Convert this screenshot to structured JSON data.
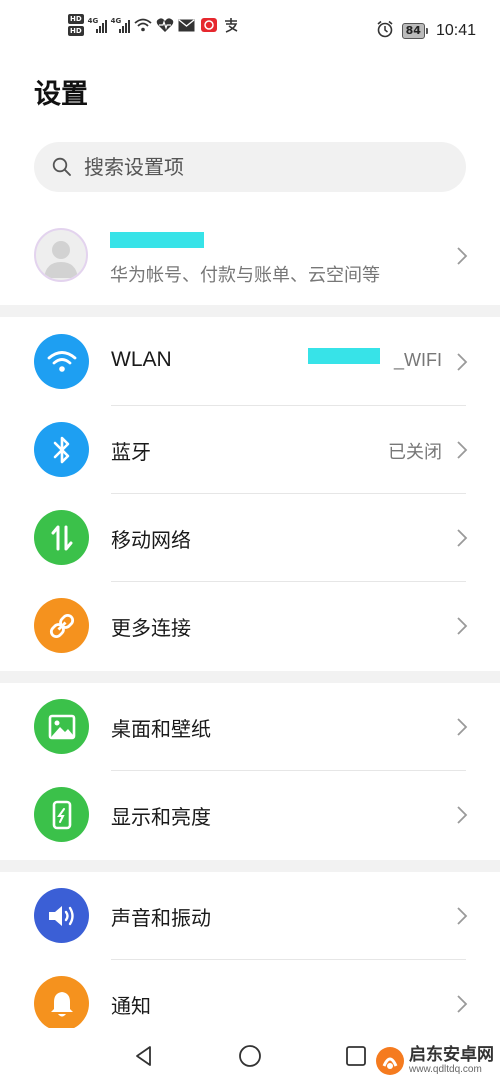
{
  "status_bar": {
    "hd_badge_1": "HD",
    "hd_badge_2": "HD",
    "network_1": "4G",
    "network_2": "4G",
    "battery": "84",
    "time": "10:41"
  },
  "page": {
    "title": "设置"
  },
  "search": {
    "placeholder": "搜索设置项"
  },
  "account": {
    "subtitle": "华为帐号、付款与账单、云空间等"
  },
  "items": [
    {
      "label": "WLAN",
      "value": "_WIFI",
      "icon": "wifi-icon",
      "color": "#1e9ff2"
    },
    {
      "label": "蓝牙",
      "value": "已关闭",
      "icon": "bluetooth-icon",
      "color": "#1e9ff2"
    },
    {
      "label": "移动网络",
      "value": "",
      "icon": "mobile-data-icon",
      "color": "#3bc14a"
    },
    {
      "label": "更多连接",
      "value": "",
      "icon": "link-icon",
      "color": "#f5921e"
    },
    {
      "label": "桌面和壁纸",
      "value": "",
      "icon": "wallpaper-icon",
      "color": "#3bc14a"
    },
    {
      "label": "显示和亮度",
      "value": "",
      "icon": "display-icon",
      "color": "#3bc14a"
    },
    {
      "label": "声音和振动",
      "value": "",
      "icon": "sound-icon",
      "color": "#3b5fd6"
    },
    {
      "label": "通知",
      "value": "",
      "icon": "notification-bell-icon",
      "color": "#f5921e"
    }
  ],
  "watermark": {
    "title": "启东安卓网",
    "url": "www.qdltdq.com"
  }
}
